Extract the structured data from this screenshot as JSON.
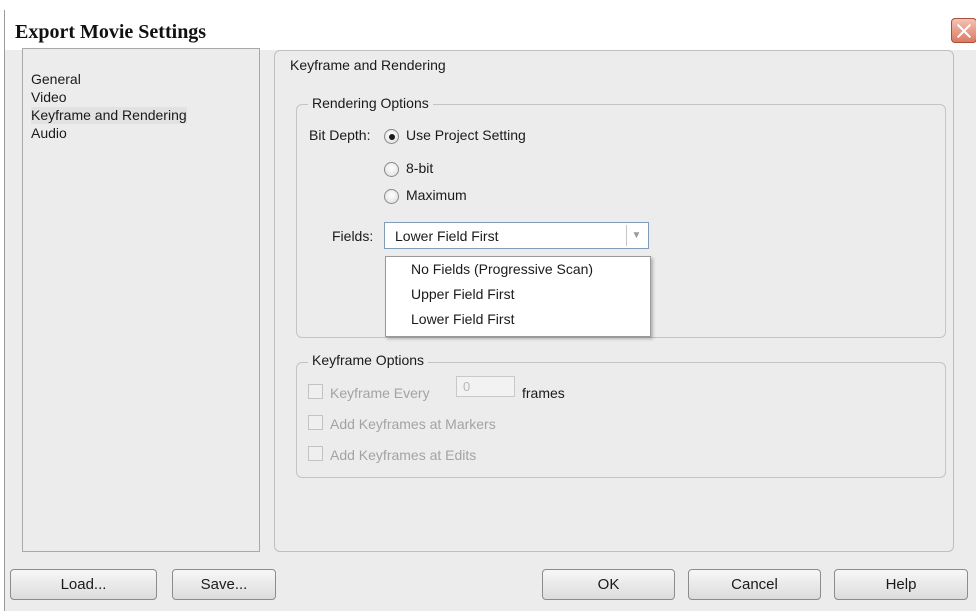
{
  "window": {
    "title": "Export Movie Settings"
  },
  "nav": {
    "items": [
      {
        "label": "General"
      },
      {
        "label": "Video"
      },
      {
        "label": "Keyframe and Rendering"
      },
      {
        "label": "Audio"
      }
    ],
    "selected_index": 2
  },
  "panel": {
    "title": "Keyframe and Rendering",
    "rendering": {
      "title": "Rendering Options",
      "bit_depth_label": "Bit Depth:",
      "bit_depth_options": [
        "Use Project Setting",
        "8-bit",
        "Maximum"
      ],
      "bit_depth_selected": "Use Project Setting",
      "fields_label": "Fields:",
      "fields_value": "Lower Field First",
      "fields_options": [
        "No Fields (Progressive Scan)",
        "Upper Field First",
        "Lower Field First"
      ]
    },
    "keyframe": {
      "title": "Keyframe Options",
      "every_label": "Keyframe Every",
      "every_value": "0",
      "frames_label": "frames",
      "at_markers_label": "Add Keyframes at Markers",
      "at_edits_label": "Add Keyframes at Edits"
    }
  },
  "buttons": {
    "load": "Load...",
    "save": "Save...",
    "ok": "OK",
    "cancel": "Cancel",
    "help": "Help"
  }
}
